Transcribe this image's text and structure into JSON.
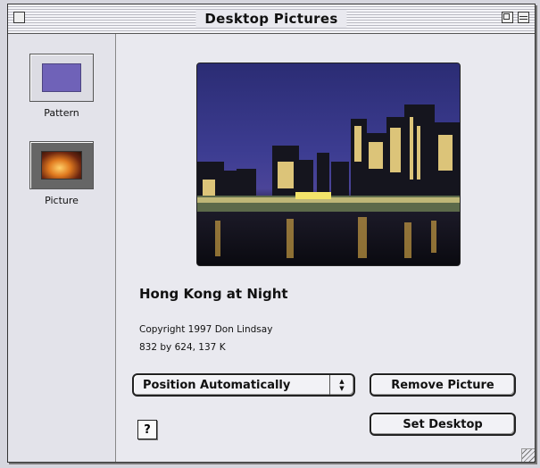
{
  "window": {
    "title": "Desktop Pictures"
  },
  "sidebar": {
    "items": [
      {
        "label": "Pattern",
        "icon": "pattern-swatch-icon"
      },
      {
        "label": "Picture",
        "icon": "picture-thumbnail-icon"
      }
    ]
  },
  "picture": {
    "title": "Hong Kong at Night",
    "copyright": "Copyright 1997 Don Lindsay",
    "info": "832 by 624, 137 K"
  },
  "controls": {
    "position_popup": "Position Automatically",
    "remove_button": "Remove Picture",
    "set_desktop_button": "Set Desktop",
    "help_button": "?"
  },
  "colors": {
    "pattern_swatch": "#6f62b8",
    "window_bg": "#e9e9ef"
  }
}
